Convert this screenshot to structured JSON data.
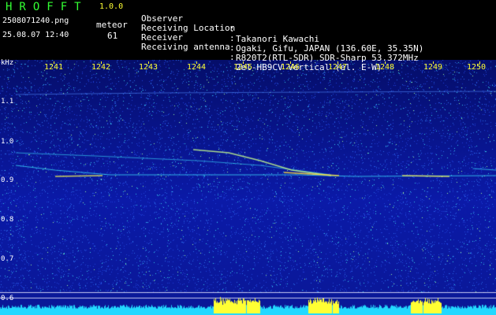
{
  "header": {
    "app_name": "HROFFT",
    "version": "1.0.0",
    "filename": "2508071240.png",
    "timestamp": "25.08.07 12:40",
    "meteor_label": "meteor",
    "meteor_count": "61",
    "info": [
      {
        "key": "Observer",
        "value": "Takanori Kawachi"
      },
      {
        "key": "Receiving Location",
        "value": "Ogaki, Gifu, JAPAN (136.60E, 35.35N)"
      },
      {
        "key": "Receiver",
        "value": "R820T2(RTL-SDR) SDR-Sharp 53.372MHz"
      },
      {
        "key": "Receiving antenna",
        "value": "2el-HB9CV Vertical (el. E-W)"
      }
    ]
  },
  "axes": {
    "unit": "kHz",
    "x_ticks": [
      "1241",
      "1242",
      "1243",
      "1244",
      "1245",
      "1246",
      "1247",
      "1248",
      "1249",
      "1250"
    ],
    "y_ticks": [
      "1.1",
      "1.0",
      "0.9",
      "0.8",
      "0.7",
      "0.6"
    ]
  },
  "colors": {
    "background": "#000000",
    "noise_floor": "#0b1aa8",
    "signal_cyan": "#33e6ff",
    "signal_yellow": "#ffff33",
    "axis_labels": "#ffff33",
    "header_title": "#33ff33"
  }
}
